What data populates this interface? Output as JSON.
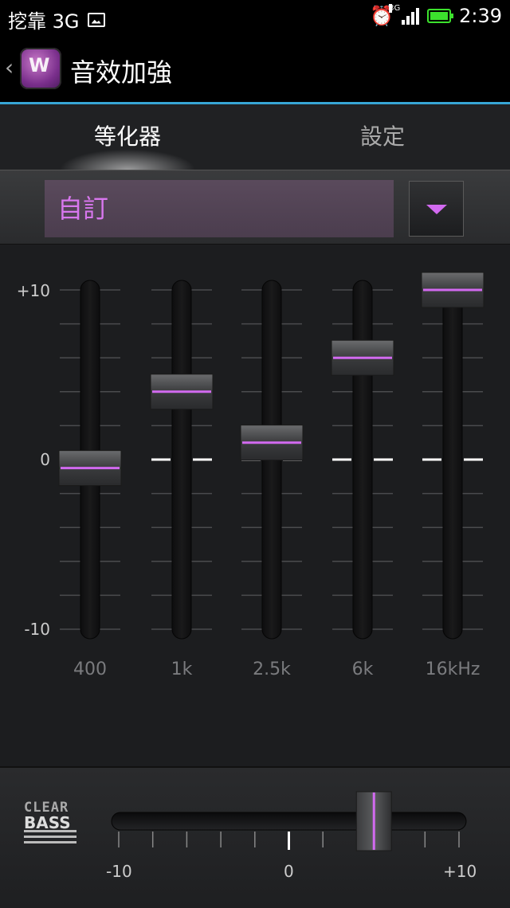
{
  "status_bar": {
    "carrier": "挖靠 3G",
    "network_tiny": "3G",
    "time": "2:39",
    "icons": [
      "gallery-icon",
      "alarm-icon",
      "signal-icon",
      "battery-icon"
    ]
  },
  "app_bar": {
    "title": "音效加強",
    "back_icon": "chevron-left-icon",
    "logo_icon": "walkman-logo-icon"
  },
  "tabs": [
    {
      "label": "等化器",
      "active": true
    },
    {
      "label": "設定",
      "active": false
    }
  ],
  "preset": {
    "selected": "自訂",
    "dropdown_icon": "triangle-down-icon"
  },
  "equalizer": {
    "scale_labels": {
      "top": "+10",
      "middle": "0",
      "bottom": "-10"
    },
    "bands": [
      {
        "label": "400",
        "value": -0.5
      },
      {
        "label": "1k",
        "value": 4.0
      },
      {
        "label": "2.5k",
        "value": 1.0
      },
      {
        "label": "6k",
        "value": 6.0
      },
      {
        "label": "16kHz",
        "value": 10.0
      }
    ],
    "range": [
      -10,
      10
    ]
  },
  "clear_bass": {
    "logo_line1": "CLEAR",
    "logo_line2": "BASS",
    "value": 5,
    "range": [
      -10,
      10
    ],
    "tick_labels": {
      "min": "-10",
      "mid": "0",
      "max": "+10"
    }
  },
  "colors": {
    "accent": "#d26af0",
    "appbar_divider": "#37a6d5",
    "battery": "#3ce12d"
  }
}
